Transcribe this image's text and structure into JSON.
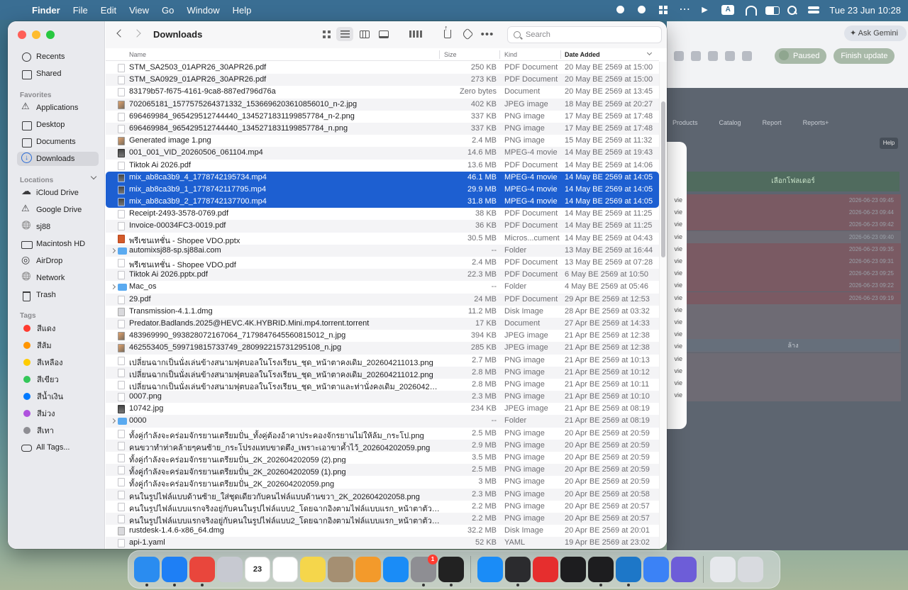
{
  "menubar": {
    "app_name": "Finder",
    "items": [
      "File",
      "Edit",
      "View",
      "Go",
      "Window",
      "Help"
    ],
    "clock": "Tue 23 Jun  10:28",
    "input_source": "A"
  },
  "background_window": {
    "gemini_button": "Ask Gemini",
    "paused_label": "Paused",
    "finish_update_label": "Finish update",
    "nav_items": [
      "Products",
      "Catalog",
      "Report",
      "Reports+"
    ],
    "help_label": "Help",
    "select_folder_label": "เลือกโฟลเดอร์",
    "rows": [
      {
        "prefix": "vie",
        "time": "2026-06-23 09:45",
        "tone": "red"
      },
      {
        "prefix": "vie",
        "time": "2026-06-23 09:44",
        "tone": "red"
      },
      {
        "prefix": "vie",
        "time": "2026-06-23 09:42",
        "tone": "red"
      },
      {
        "prefix": "vie",
        "time": "2026-06-23 09:40",
        "tone": "normal"
      },
      {
        "prefix": "vie",
        "time": "2026-06-23 09:35",
        "tone": "red"
      },
      {
        "prefix": "vie",
        "time": "2026-06-23 09:31",
        "tone": "red"
      },
      {
        "prefix": "vie",
        "time": "2026-06-23 09:25",
        "tone": "red"
      },
      {
        "prefix": "vie",
        "time": "2026-06-23 09:22",
        "tone": "red"
      },
      {
        "prefix": "vie",
        "time": "2026-06-23 09:19",
        "tone": "red"
      },
      {
        "prefix": "vie",
        "time": "",
        "tone": "normal"
      },
      {
        "prefix": "vie",
        "time": "",
        "tone": "normal"
      },
      {
        "prefix": "vie",
        "time": "",
        "tone": "normal"
      },
      {
        "prefix": "vie",
        "time": "",
        "tone": "normal"
      },
      {
        "prefix": "vie",
        "time": "",
        "tone": "normal"
      },
      {
        "prefix": "vie",
        "time": "",
        "tone": "normal"
      },
      {
        "prefix": "vie",
        "time": "",
        "tone": "normal"
      },
      {
        "prefix": "vie",
        "time": "",
        "tone": "normal"
      }
    ],
    "center_label": "ล้าง"
  },
  "sidebar": {
    "top_items": [
      {
        "label": "Recents",
        "icon": "clock-icon"
      },
      {
        "label": "Shared",
        "icon": "shared-folder-icon"
      }
    ],
    "favorites_header": "Favorites",
    "favorites": [
      {
        "label": "Applications",
        "icon": "applications-icon",
        "selected": false
      },
      {
        "label": "Desktop",
        "icon": "desktop-icon",
        "selected": false
      },
      {
        "label": "Documents",
        "icon": "documents-icon",
        "selected": false
      },
      {
        "label": "Downloads",
        "icon": "downloads-icon",
        "selected": true
      }
    ],
    "locations_header": "Locations",
    "locations": [
      {
        "label": "iCloud Drive",
        "icon": "cloud-icon"
      },
      {
        "label": "Google Drive",
        "icon": "google-drive-icon"
      },
      {
        "label": "sj88",
        "icon": "globe-icon"
      },
      {
        "label": "Macintosh HD",
        "icon": "drive-icon"
      },
      {
        "label": "AirDrop",
        "icon": "airdrop-icon"
      },
      {
        "label": "Network",
        "icon": "network-icon"
      },
      {
        "label": "Trash",
        "icon": "trash-icon"
      }
    ],
    "tags_header": "Tags",
    "tags": [
      {
        "label": "สีแดง",
        "color": "#ff3b30"
      },
      {
        "label": "สีส้ม",
        "color": "#ff9500"
      },
      {
        "label": "สีเหลือง",
        "color": "#ffcc00"
      },
      {
        "label": "สีเขียว",
        "color": "#34c759"
      },
      {
        "label": "สีน้ำเงิน",
        "color": "#007aff"
      },
      {
        "label": "สีม่วง",
        "color": "#af52de"
      },
      {
        "label": "สีเทา",
        "color": "#8e8e93"
      }
    ],
    "all_tags_label": "All Tags..."
  },
  "toolbar": {
    "title": "Downloads",
    "search_placeholder": "Search"
  },
  "columns": {
    "name": "Name",
    "size": "Size",
    "kind": "Kind",
    "date_added": "Date Added"
  },
  "files": [
    {
      "name": "STM_SA2503_01APR26_30APR26.pdf",
      "size": "250 KB",
      "kind": "PDF Document",
      "date": "20 May BE 2569 at 15:00",
      "icon": "doc"
    },
    {
      "name": "STM_SA0929_01APR26_30APR26.pdf",
      "size": "273 KB",
      "kind": "PDF Document",
      "date": "20 May BE 2569 at 15:00",
      "icon": "doc"
    },
    {
      "name": "83179b57-f675-4161-9ca8-887ed796d76a",
      "size": "Zero bytes",
      "kind": "Document",
      "date": "20 May BE 2569 at 13:45",
      "icon": "doc"
    },
    {
      "name": "702065181_1577575264371332_1536696203610856010_n-2.jpg",
      "size": "402 KB",
      "kind": "JPEG image",
      "date": "18 May BE 2569 at 20:27",
      "icon": "img"
    },
    {
      "name": "696469984_965429512744440_1345271831199857784_n-2.png",
      "size": "337 KB",
      "kind": "PNG image",
      "date": "17 May BE 2569 at 17:48",
      "icon": "doc"
    },
    {
      "name": "696469984_965429512744440_1345271831199857784_n.png",
      "size": "337 KB",
      "kind": "PNG image",
      "date": "17 May BE 2569 at 17:48",
      "icon": "doc"
    },
    {
      "name": "Generated image 1.png",
      "size": "2.4 MB",
      "kind": "PNG image",
      "date": "15 May BE 2569 at 11:32",
      "icon": "img"
    },
    {
      "name": "001_001_VID_20260506_061104.mp4",
      "size": "14.6 MB",
      "kind": "MPEG-4 movie",
      "date": "14 May BE 2569 at 19:43",
      "icon": "vid"
    },
    {
      "name": "Tiktok Ai 2026.pdf",
      "size": "13.6 MB",
      "kind": "PDF Document",
      "date": "14 May BE 2569 at 14:06",
      "icon": "doc"
    },
    {
      "name": "mix_ab8ca3b9_4_1778742195734.mp4",
      "size": "46.1 MB",
      "kind": "MPEG-4 movie",
      "date": "14 May BE 2569 at 14:05",
      "icon": "vid",
      "selected": true
    },
    {
      "name": "mix_ab8ca3b9_1_1778742117795.mp4",
      "size": "29.9 MB",
      "kind": "MPEG-4 movie",
      "date": "14 May BE 2569 at 14:05",
      "icon": "vid",
      "selected": true
    },
    {
      "name": "mix_ab8ca3b9_2_1778742137700.mp4",
      "size": "31.8 MB",
      "kind": "MPEG-4 movie",
      "date": "14 May BE 2569 at 14:05",
      "icon": "vid",
      "selected": true
    },
    {
      "name": "Receipt-2493-3578-0769.pdf",
      "size": "38 KB",
      "kind": "PDF Document",
      "date": "14 May BE 2569 at 11:25",
      "icon": "doc"
    },
    {
      "name": "Invoice-00034FC3-0019.pdf",
      "size": "36 KB",
      "kind": "PDF Document",
      "date": "14 May BE 2569 at 11:25",
      "icon": "doc"
    },
    {
      "name": "พรีเซนเทชั่น - Shopee VDO.pptx",
      "size": "30.5 MB",
      "kind": "Micros...cument",
      "date": "14 May BE 2569 at 04:43",
      "icon": "ppt"
    },
    {
      "name": "automixsj88-sp.sj88ai.com",
      "size": "--",
      "kind": "Folder",
      "date": "13 May BE 2569 at 16:44",
      "icon": "folder",
      "expandable": true
    },
    {
      "name": "พรีเซนเทชั่น - Shopee VDO.pdf",
      "size": "2.4 MB",
      "kind": "PDF Document",
      "date": "13 May BE 2569 at 07:28",
      "icon": "doc"
    },
    {
      "name": "Tiktok Ai 2026.pptx.pdf",
      "size": "22.3 MB",
      "kind": "PDF Document",
      "date": "6 May BE 2569 at 10:50",
      "icon": "doc"
    },
    {
      "name": "Mac_os",
      "size": "--",
      "kind": "Folder",
      "date": "4 May BE 2569 at 05:46",
      "icon": "folder",
      "expandable": true
    },
    {
      "name": "29.pdf",
      "size": "24 MB",
      "kind": "PDF Document",
      "date": "29 Apr BE 2569 at 12:53",
      "icon": "doc"
    },
    {
      "name": "Transmission-4.1.1.dmg",
      "size": "11.2 MB",
      "kind": "Disk Image",
      "date": "28 Apr BE 2569 at 03:32",
      "icon": "dmg"
    },
    {
      "name": "Predator.Badlands.2025@HEVC.4K.HYBRID.Mini.mp4.torrent.torrent",
      "size": "17 KB",
      "kind": "Document",
      "date": "27 Apr BE 2569 at 14:33",
      "icon": "doc"
    },
    {
      "name": "483969990_993828072167064_7179847645560815012_n.jpg",
      "size": "394 KB",
      "kind": "JPEG image",
      "date": "21 Apr BE 2569 at 12:38",
      "icon": "img"
    },
    {
      "name": "462553405_599719815733749_280992215731295108_n.jpg",
      "size": "285 KB",
      "kind": "JPEG image",
      "date": "21 Apr BE 2569 at 12:38",
      "icon": "img"
    },
    {
      "name": "เปลี่ยนฉากเป็นนั่งเล่นข้างสนามฟุตบอลในโรงเรียน_ชุด_หน้าตาคงเดิม_202604211013.png",
      "size": "2.7 MB",
      "kind": "PNG image",
      "date": "21 Apr BE 2569 at 10:13",
      "icon": "doc"
    },
    {
      "name": "เปลี่ยนฉากเป็นนั่งเล่นข้างสนามฟุตบอลในโรงเรียน_ชุด_หน้าตาคงเดิม_202604211012.png",
      "size": "2.8 MB",
      "kind": "PNG image",
      "date": "21 Apr BE 2569 at 10:12",
      "icon": "doc"
    },
    {
      "name": "เปลี่ยนฉากเป็นนั่งเล่นข้างสนามฟุตบอลในโรงเรียน_ชุด_หน้าตาและท่านั่งคงเดิม_202604211011.png",
      "size": "2.8 MB",
      "kind": "PNG image",
      "date": "21 Apr BE 2569 at 10:11",
      "icon": "doc"
    },
    {
      "name": "0007.png",
      "size": "2.3 MB",
      "kind": "PNG image",
      "date": "21 Apr BE 2569 at 10:10",
      "icon": "doc"
    },
    {
      "name": "10742.jpg",
      "size": "234 KB",
      "kind": "JPEG image",
      "date": "21 Apr BE 2569 at 08:19",
      "icon": "vid"
    },
    {
      "name": "0000",
      "size": "--",
      "kind": "Folder",
      "date": "21 Apr BE 2569 at 08:19",
      "icon": "folder",
      "expandable": true
    },
    {
      "name": "ทั้งคู่กำลังจะคร่อมจักรยานเตรียมปั่น_ทั้งคู่ต้องอ้าคาประคองจักรยานไม่ให้ล้ม_กระโป.png",
      "size": "2.5 MB",
      "kind": "PNG image",
      "date": "20 Apr BE 2569 at 20:59",
      "icon": "doc"
    },
    {
      "name": "คนขวาทำท่าคล้ายๆคนซ้าย_กระโปรงแทบขาดตึง_เพราะเอาขาค้ำไว้_202604202059.png",
      "size": "2.9 MB",
      "kind": "PNG image",
      "date": "20 Apr BE 2569 at 20:59",
      "icon": "doc"
    },
    {
      "name": "ทั้งคู่กำลังจะคร่อมจักรยานเตรียมปั่น_2K_202604202059 (2).png",
      "size": "3.5 MB",
      "kind": "PNG image",
      "date": "20 Apr BE 2569 at 20:59",
      "icon": "doc"
    },
    {
      "name": "ทั้งคู่กำลังจะคร่อมจักรยานเตรียมปั่น_2K_202604202059 (1).png",
      "size": "2.5 MB",
      "kind": "PNG image",
      "date": "20 Apr BE 2569 at 20:59",
      "icon": "doc"
    },
    {
      "name": "ทั้งคู่กำลังจะคร่อมจักรยานเตรียมปั่น_2K_202604202059.png",
      "size": "3 MB",
      "kind": "PNG image",
      "date": "20 Apr BE 2569 at 20:59",
      "icon": "doc"
    },
    {
      "name": "คนในรูปไฟล์แบบด้านซ้าย_ใส่ชุดเดียวกับคนไฟล์แบบด้านขวา_2K_202604202058.png",
      "size": "2.3 MB",
      "kind": "PNG image",
      "date": "20 Apr BE 2569 at 20:58",
      "icon": "doc"
    },
    {
      "name": "คนในรูปไฟล์แบบแรกจริงอยู่กับคนในรูปไฟล์แบบ2_โดยฉากอิงตามไฟล์แบบแรก_หน้าตาตัวละคร (1).png",
      "size": "2.2 MB",
      "kind": "PNG image",
      "date": "20 Apr BE 2569 at 20:57",
      "icon": "doc"
    },
    {
      "name": "คนในรูปไฟล์แบบแรกจริงอยู่กับคนในรูปไฟล์แบบ2_โดยฉากอิงตามไฟล์แบบแรก_หน้าตาตัวละครที่.png",
      "size": "2.2 MB",
      "kind": "PNG image",
      "date": "20 Apr BE 2569 at 20:57",
      "icon": "doc"
    },
    {
      "name": "rustdesk-1.4.6-x86_64.dmg",
      "size": "32.2 MB",
      "kind": "Disk Image",
      "date": "20 Apr BE 2569 at 20:01",
      "icon": "dmg"
    },
    {
      "name": "api-1.yaml",
      "size": "52 KB",
      "kind": "YAML",
      "date": "19 Apr BE 2569 at 23:02",
      "icon": "doc"
    }
  ],
  "dock": {
    "apps": [
      {
        "name": "finder-app",
        "color": "#2a8cf0",
        "label": "",
        "running": true
      },
      {
        "name": "safari-app",
        "color": "#1e7ff5",
        "label": "",
        "running": true
      },
      {
        "name": "chrome-app",
        "color": "#e9463c",
        "label": "",
        "running": true
      },
      {
        "name": "launchpad-app",
        "color": "#c7c9d1",
        "label": "",
        "running": false
      },
      {
        "name": "calendar-app",
        "color": "#ffffff",
        "label": "23",
        "running": false
      },
      {
        "name": "reminders-app",
        "color": "#ffffff",
        "label": "",
        "running": false
      },
      {
        "name": "notes-app",
        "color": "#f5d64b",
        "label": "",
        "running": false
      },
      {
        "name": "contacts-app",
        "color": "#a58f72",
        "label": "",
        "running": false
      },
      {
        "name": "pages-app",
        "color": "#f39a2b",
        "label": "",
        "running": false
      },
      {
        "name": "app-store-app",
        "color": "#1a8cf7",
        "label": "",
        "running": false
      },
      {
        "name": "system-settings-app",
        "color": "#8e8e93",
        "label": "",
        "running": true,
        "badge": "1"
      },
      {
        "name": "image-app",
        "color": "#222222",
        "label": "",
        "running": true
      },
      {
        "name": "windows-app",
        "color": "#1a8cf7",
        "label": "",
        "running": false
      },
      {
        "name": "grid-app",
        "color": "#2b2b2e",
        "label": "",
        "running": true
      },
      {
        "name": "red-app",
        "color": "#e62e2e",
        "label": "",
        "running": false
      },
      {
        "name": "activity-monitor-app",
        "color": "#1d1d1f",
        "label": "",
        "running": false
      },
      {
        "name": "terminal-app",
        "color": "#1d1d1f",
        "label": "",
        "running": true
      },
      {
        "name": "vscode-app",
        "color": "#1d77c8",
        "label": "",
        "running": true
      },
      {
        "name": "q-app",
        "color": "#3b82f6",
        "label": "",
        "running": false
      },
      {
        "name": "chat-app",
        "color": "#6d5dd8",
        "label": "",
        "running": false
      },
      {
        "name": "preview-folder-app",
        "color": "#e6e8ec",
        "label": "",
        "running": false
      },
      {
        "name": "trash-app",
        "color": "#d8dadf",
        "label": "",
        "running": false
      }
    ]
  }
}
